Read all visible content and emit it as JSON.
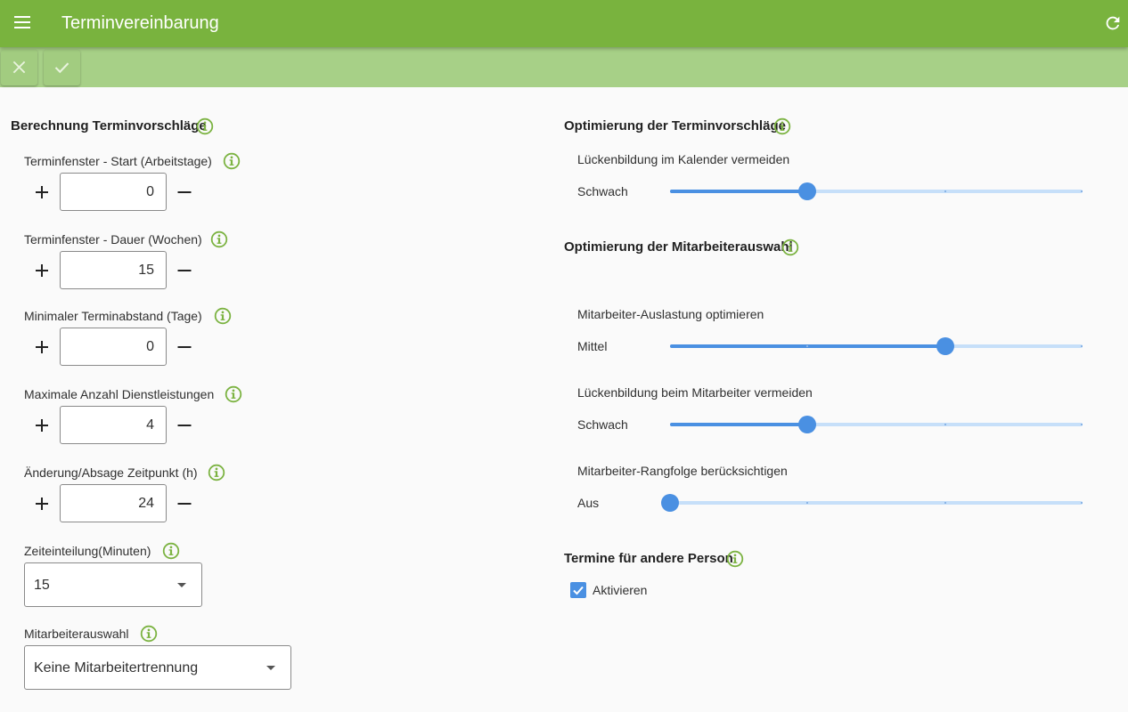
{
  "app": {
    "title": "Terminvereinbarung"
  },
  "left": {
    "title": "Berechnung Terminvorschläge",
    "fields": [
      {
        "label": "Terminfenster - Start (Arbeitstage)",
        "value": "0"
      },
      {
        "label": "Terminfenster - Dauer (Wochen)",
        "value": "15"
      },
      {
        "label": "Minimaler Terminabstand (Tage)",
        "value": "0"
      },
      {
        "label": "Maximale Anzahl Dienstleistungen",
        "value": "4"
      },
      {
        "label": "Änderung/Absage Zeitpunkt (h)",
        "value": "24"
      }
    ],
    "zeiteinteilung": {
      "label": "Zeiteinteilung(Minuten)",
      "value": "15"
    },
    "mitarbeiterauswahl": {
      "label": "Mitarbeiterauswahl",
      "value": "Keine Mitarbeitertrennung"
    }
  },
  "right": {
    "opt_termin": {
      "title": "Optimierung der Terminvorschläge",
      "sliders": [
        {
          "label": "Lückenbildung im Kalender vermeiden",
          "level": "Schwach",
          "value": 1,
          "max": 3
        }
      ]
    },
    "opt_mitarbeiter": {
      "title": "Optimierung der Mitarbeiterauswahl",
      "sliders": [
        {
          "label": "Mitarbeiter-Auslastung optimieren",
          "level": "Mittel",
          "value": 2,
          "max": 3
        },
        {
          "label": "Lückenbildung beim Mitarbeiter vermeiden",
          "level": "Schwach",
          "value": 1,
          "max": 3
        },
        {
          "label": "Mitarbeiter-Rangfolge berücksichtigen",
          "level": "Aus",
          "value": 0,
          "max": 3
        }
      ]
    },
    "andere_person": {
      "title": "Termine für andere Person",
      "checkbox_label": "Aktivieren",
      "checked": true
    }
  },
  "colors": {
    "appbar": "#79b33e",
    "toolbar": "#a7d087",
    "info_icon": "#7cb342",
    "slider": "#4a90e2",
    "slider_rail": "#c6dff9"
  }
}
